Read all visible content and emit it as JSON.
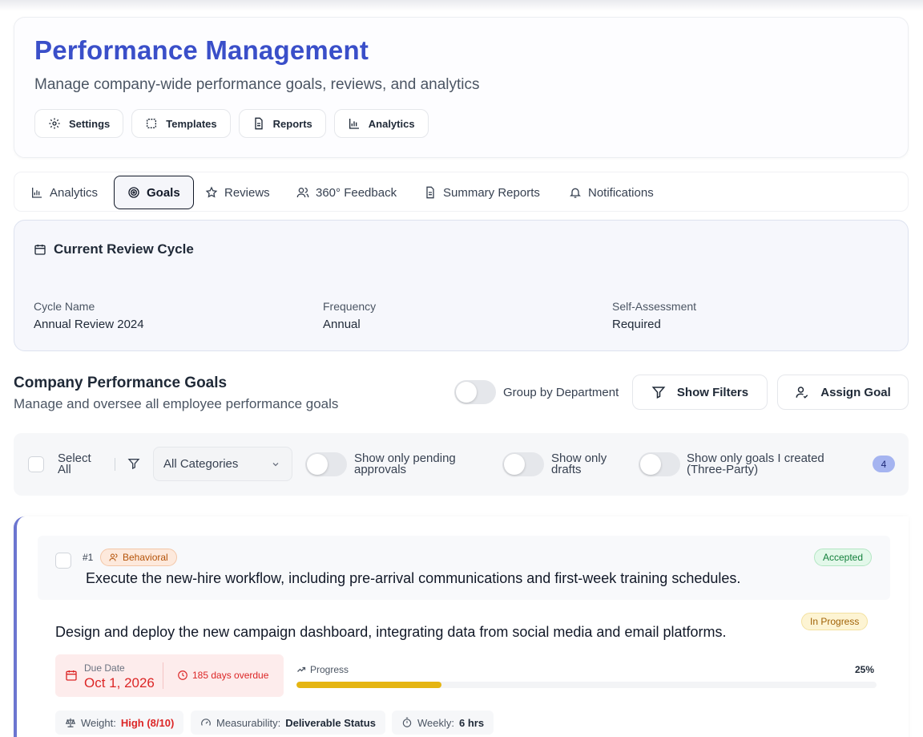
{
  "header": {
    "title": "Performance Management",
    "subtitle": "Manage company-wide performance goals, reviews, and analytics",
    "buttons": [
      {
        "label": "Settings",
        "icon": "gear-icon"
      },
      {
        "label": "Templates",
        "icon": "template-icon"
      },
      {
        "label": "Reports",
        "icon": "document-icon"
      },
      {
        "label": "Analytics",
        "icon": "bar-chart-icon"
      }
    ]
  },
  "tabs": [
    {
      "label": "Analytics",
      "icon": "bar-chart-icon",
      "active": false
    },
    {
      "label": "Goals",
      "icon": "target-icon",
      "active": true
    },
    {
      "label": "Reviews",
      "icon": "star-icon",
      "active": false
    },
    {
      "label": "360° Feedback",
      "icon": "users-icon",
      "active": false
    },
    {
      "label": "Summary Reports",
      "icon": "document-icon",
      "active": false
    },
    {
      "label": "Notifications",
      "icon": "bell-icon",
      "active": false
    }
  ],
  "review_cycle": {
    "title": "Current Review Cycle",
    "fields": [
      {
        "label": "Cycle Name",
        "value": "Annual Review 2024"
      },
      {
        "label": "Frequency",
        "value": "Annual"
      },
      {
        "label": "Self-Assessment",
        "value": "Required"
      }
    ]
  },
  "goals_section": {
    "title": "Company Performance Goals",
    "subtitle": "Manage and oversee all employee performance goals",
    "group_toggle_label": "Group by Department",
    "show_filters_label": "Show Filters",
    "assign_goal_label": "Assign Goal"
  },
  "filters": {
    "select_all_label": "Select All",
    "category_select": "All Categories",
    "pending_label": "Show only pending approvals",
    "drafts_label": "Show only drafts",
    "created_label": "Show only goals I created (Three-Party)",
    "count": "4"
  },
  "goal": {
    "number": "#1",
    "category": "Behavioral",
    "status": "Accepted",
    "title": "Execute the new-hire workflow, including pre-arrival communications and first-week training schedules.",
    "progress_status": "In Progress",
    "description": "Design and deploy the new campaign dashboard, integrating data from social media and email platforms.",
    "due_label": "Due Date",
    "due_date": "Oct 1, 2026",
    "overdue": "185 days overdue",
    "progress_label": "Progress",
    "progress_pct": "25%",
    "progress_value": 0.25,
    "weight_label": "Weight:",
    "weight_value": "High (8/10)",
    "measurability_label": "Measurability:",
    "measurability_value": "Deliverable Status",
    "weekly_label": "Weekly:",
    "weekly_value": "6 hrs"
  },
  "colors": {
    "title_blue": "#3a4fc9",
    "accent_border": "#6b75d0",
    "progress_fill": "#e5b512",
    "overdue_red": "#dc2626"
  }
}
